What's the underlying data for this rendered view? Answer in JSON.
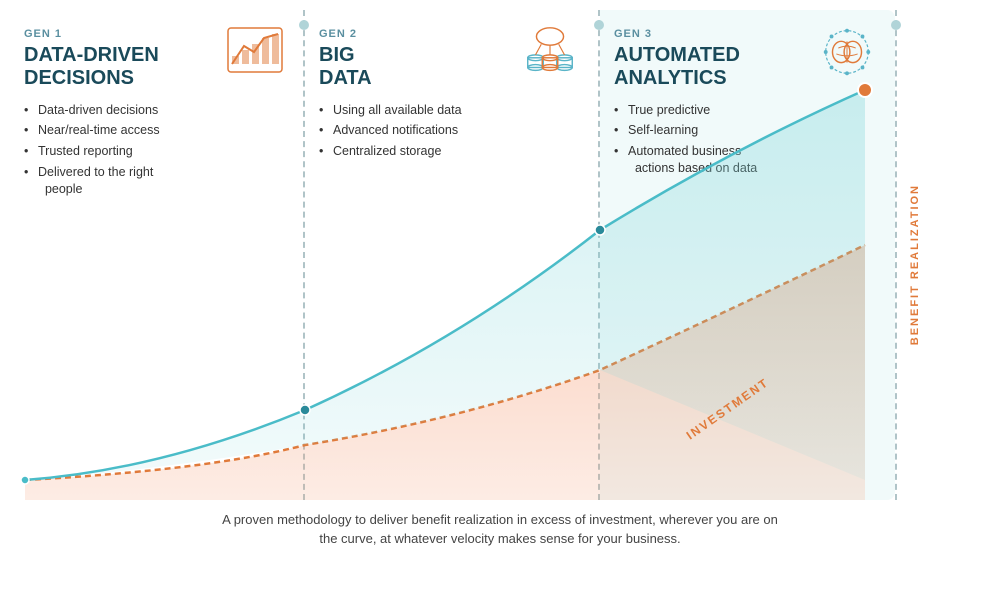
{
  "gen1": {
    "label": "GEN 1",
    "title": "DATA-DRIVEN\nDECISIONS",
    "bullets": [
      "Data-driven decisions",
      "Near/real-time access",
      "Trusted reporting",
      "Delivered to the right people"
    ]
  },
  "gen2": {
    "label": "GEN 2",
    "title": "BIG\nDATA",
    "bullets": [
      "Using all available data",
      "Advanced notifications",
      "Centralized storage"
    ]
  },
  "gen3": {
    "label": "GEN 3",
    "title": "AUTOMATED\nANALYTICS",
    "bullets": [
      "True predictive",
      "Self-learning",
      "Automated business actions based on data"
    ]
  },
  "sidebar": {
    "benefit_label": "BENEFIT REALIZATION",
    "investment_label": "INVESTMENT"
  },
  "footer": {
    "text": "A proven methodology to deliver benefit realization in excess of investment, wherever you are on\nthe curve, at whatever velocity makes sense for your business."
  }
}
